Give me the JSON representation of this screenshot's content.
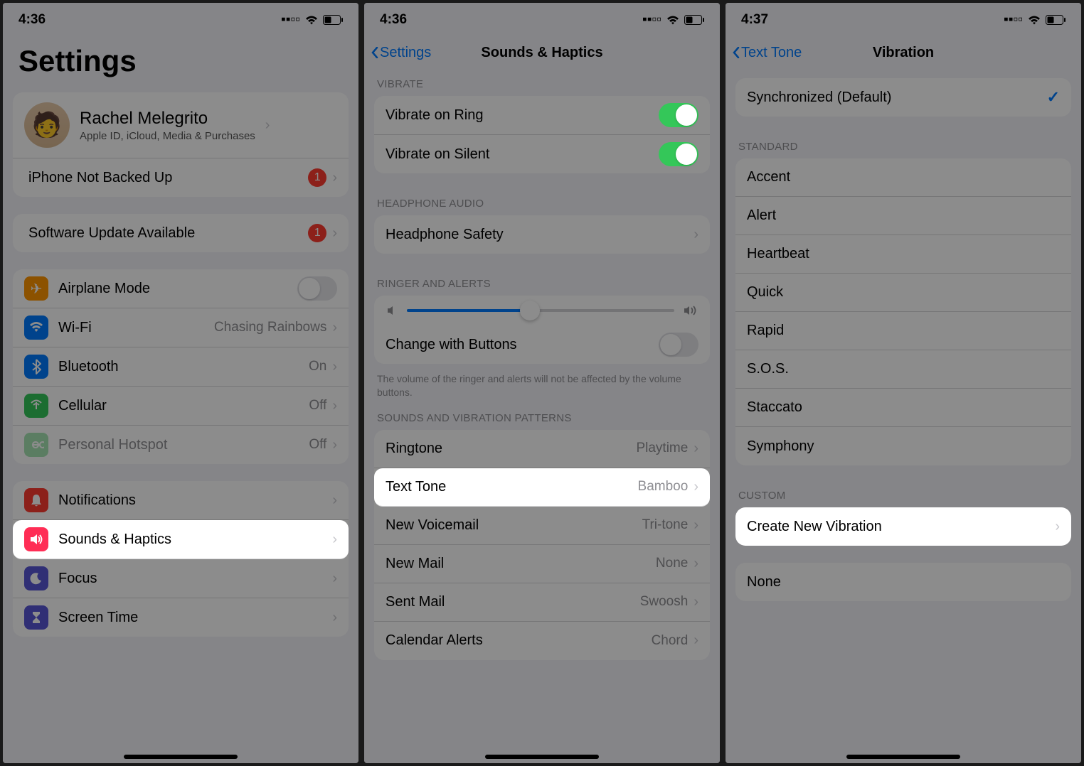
{
  "screen1": {
    "time": "4:36",
    "title": "Settings",
    "profile_name": "Rachel Melegrito",
    "profile_sub": "Apple ID, iCloud, Media & Purchases",
    "backup_label": "iPhone Not Backed Up",
    "backup_badge": "1",
    "update_label": "Software Update Available",
    "update_badge": "1",
    "airplane": "Airplane Mode",
    "wifi_label": "Wi-Fi",
    "wifi_value": "Chasing Rainbows",
    "bluetooth_label": "Bluetooth",
    "bluetooth_value": "On",
    "cellular_label": "Cellular",
    "cellular_value": "Off",
    "hotspot_label": "Personal Hotspot",
    "hotspot_value": "Off",
    "notifications_label": "Notifications",
    "sounds_label": "Sounds & Haptics",
    "focus_label": "Focus",
    "screentime_label": "Screen Time"
  },
  "screen2": {
    "time": "4:36",
    "back": "Settings",
    "title": "Sounds & Haptics",
    "vibrate_header": "VIBRATE",
    "vibrate_ring": "Vibrate on Ring",
    "vibrate_silent": "Vibrate on Silent",
    "headphone_header": "HEADPHONE AUDIO",
    "headphone_safety": "Headphone Safety",
    "ringer_header": "RINGER AND ALERTS",
    "change_buttons": "Change with Buttons",
    "ringer_footer": "The volume of the ringer and alerts will not be affected by the volume buttons.",
    "sounds_header": "SOUNDS AND VIBRATION PATTERNS",
    "ringtone_label": "Ringtone",
    "ringtone_value": "Playtime",
    "texttone_label": "Text Tone",
    "texttone_value": "Bamboo",
    "voicemail_label": "New Voicemail",
    "voicemail_value": "Tri-tone",
    "newmail_label": "New Mail",
    "newmail_value": "None",
    "sentmail_label": "Sent Mail",
    "sentmail_value": "Swoosh",
    "calendar_label": "Calendar Alerts",
    "calendar_value": "Chord"
  },
  "screen3": {
    "time": "4:37",
    "back": "Text Tone",
    "title": "Vibration",
    "default_label": "Synchronized (Default)",
    "standard_header": "STANDARD",
    "standard": [
      "Accent",
      "Alert",
      "Heartbeat",
      "Quick",
      "Rapid",
      "S.O.S.",
      "Staccato",
      "Symphony"
    ],
    "custom_header": "CUSTOM",
    "create_label": "Create New Vibration",
    "none_label": "None"
  }
}
